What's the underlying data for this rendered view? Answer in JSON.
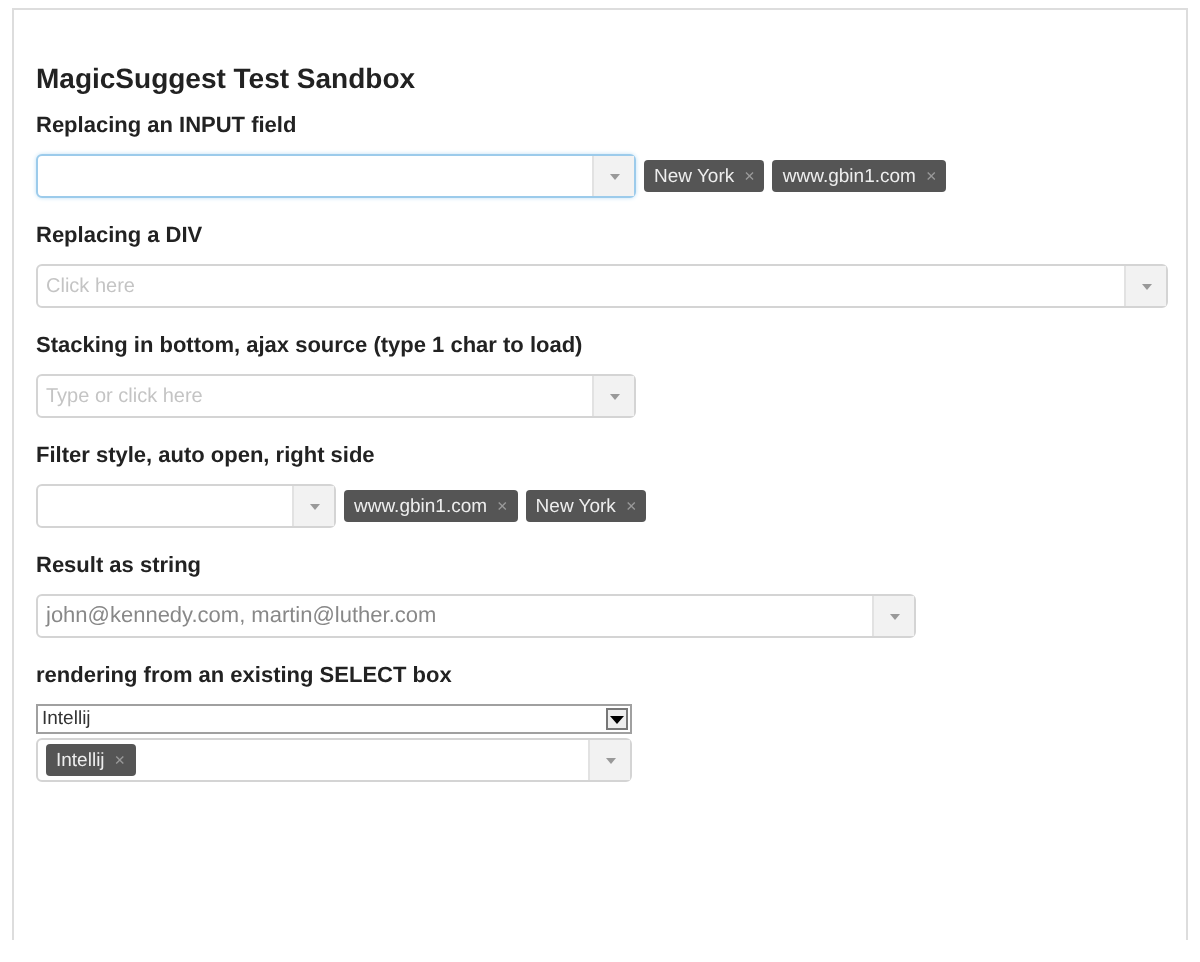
{
  "title": "MagicSuggest Test Sandbox",
  "sections": [
    {
      "label": "Replacing an INPUT field",
      "field": {
        "kind": "tags-beside",
        "focused": true,
        "tags": [
          {
            "text": "New York",
            "remove": "×"
          },
          {
            "text": "www.gbin1.com",
            "remove": "×"
          }
        ]
      }
    },
    {
      "label": "Replacing a DIV",
      "field": {
        "kind": "tags-beside",
        "focused": false,
        "placeholder": "Click here"
      }
    },
    {
      "label": "Stacking in bottom, ajax source (type 1 char to load)",
      "field": {
        "kind": "tags-beside",
        "focused": false,
        "placeholder": "Type or click here"
      }
    },
    {
      "label": "Filter style, auto open, right side",
      "field": {
        "kind": "tags-beside",
        "focused": false,
        "tags": [
          {
            "text": "www.gbin1.com",
            "remove": "×"
          },
          {
            "text": "New York",
            "remove": "×"
          }
        ]
      }
    },
    {
      "label": "Result as string",
      "field": {
        "kind": "tags-beside",
        "focused": false,
        "value": "john@kennedy.com, martin@luther.com"
      }
    },
    {
      "label": "rendering from an existing SELECT box",
      "select": {
        "value": "Intellij"
      },
      "field": {
        "kind": "tags-inside",
        "focused": false,
        "tags": [
          {
            "text": "Intellij",
            "remove": "×"
          }
        ]
      }
    }
  ]
}
